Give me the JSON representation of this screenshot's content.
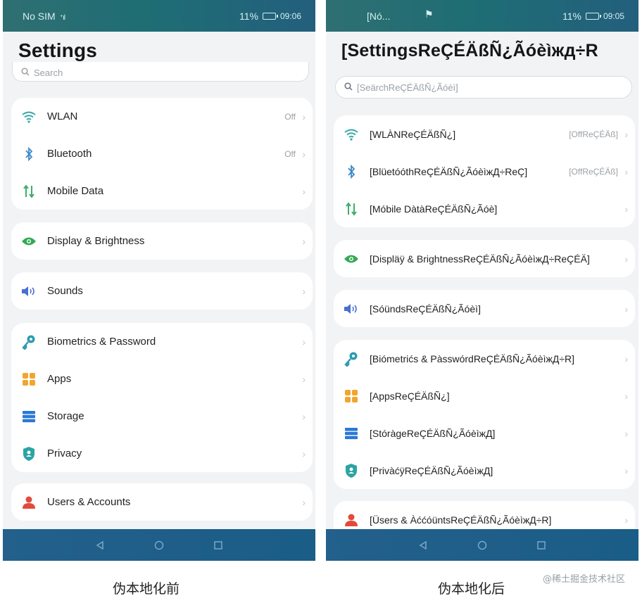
{
  "colors": {
    "statusbar_gradient": [
      "#2f6f72",
      "#235f7d"
    ],
    "navbar": "#1f5e88",
    "wifi": "#3aa6a7",
    "bluetooth": "#3c89c9",
    "mobile_data": "#3fae6a",
    "display": "#34a853",
    "sounds": "#4a6fd1",
    "biometrics": "#2a9bb0",
    "apps": "#f2a52c",
    "storage": "#2b78d4",
    "privacy": "#2ca3a5",
    "users": "#e14b3c"
  },
  "before": {
    "status": {
      "carrier": "No SIM",
      "battery": "11%",
      "time": "09:06"
    },
    "title": "Settings",
    "search_placeholder": "Search",
    "groups": [
      {
        "items": [
          {
            "icon": "wifi-icon",
            "label": "WLAN",
            "value": "Off"
          },
          {
            "icon": "bluetooth-icon",
            "label": "Bluetooth",
            "value": "Off"
          },
          {
            "icon": "mobile-data-icon",
            "label": "Mobile Data",
            "value": ""
          }
        ]
      },
      {
        "items": [
          {
            "icon": "eye-icon",
            "label": "Display & Brightness",
            "value": ""
          }
        ]
      },
      {
        "items": [
          {
            "icon": "speaker-icon",
            "label": "Sounds",
            "value": ""
          }
        ]
      },
      {
        "items": [
          {
            "icon": "key-icon",
            "label": "Biometrics & Password",
            "value": ""
          },
          {
            "icon": "apps-grid-icon",
            "label": "Apps",
            "value": ""
          },
          {
            "icon": "storage-icon",
            "label": "Storage",
            "value": ""
          },
          {
            "icon": "privacy-shield-icon",
            "label": "Privacy",
            "value": ""
          }
        ]
      },
      {
        "items": [
          {
            "icon": "user-icon",
            "label": "Users & Accounts",
            "value": ""
          }
        ]
      }
    ]
  },
  "after": {
    "status": {
      "carrier": "[Nó...",
      "battery": "11%",
      "time": "09:05"
    },
    "title": "[SettingsReÇÉÄßÑ¿Ãóèìжд÷R",
    "search_placeholder": "[SeärchReÇÉÄßÑ¿Ãóèì]",
    "groups": [
      {
        "items": [
          {
            "icon": "wifi-icon",
            "label": "[WLÀNReÇÉÄßÑ¿]",
            "value": "[OffReÇÉÄß]"
          },
          {
            "icon": "bluetooth-icon",
            "label": "[BlüetóóthReÇÉÄßÑ¿ÃóèìжД÷ReÇ]",
            "value": "[OffReÇÉÄß]"
          },
          {
            "icon": "mobile-data-icon",
            "label": "[Móbile DàtàReÇÉÄßÑ¿Ãóè]",
            "value": ""
          }
        ]
      },
      {
        "items": [
          {
            "icon": "eye-icon",
            "label": "[Displäÿ & BrightnessReÇÉÄßÑ¿ÃóèìжД÷ReÇÉÄ]",
            "value": ""
          }
        ]
      },
      {
        "items": [
          {
            "icon": "speaker-icon",
            "label": "[SóündsReÇÉÄßÑ¿Ãóèì]",
            "value": ""
          }
        ]
      },
      {
        "items": [
          {
            "icon": "key-icon",
            "label": "[Biómetrićs & PàsswórdReÇÉÄßÑ¿ÃóèìжД÷R]",
            "value": ""
          },
          {
            "icon": "apps-grid-icon",
            "label": "[AppsReÇÉÄßÑ¿]",
            "value": ""
          },
          {
            "icon": "storage-icon",
            "label": "[StóràgeReÇÉÄßÑ¿ÃóèìжД]",
            "value": ""
          },
          {
            "icon": "privacy-shield-icon",
            "label": "[PrivàćÿReÇÉÄßÑ¿ÃóèìжД]",
            "value": ""
          }
        ]
      },
      {
        "items": [
          {
            "icon": "user-icon",
            "label": "[Üsers & ÀććóüntsReÇÉÄßÑ¿ÃóèìжД÷R]",
            "value": ""
          }
        ]
      }
    ]
  },
  "captions": {
    "left": "伪本地化前",
    "right": "伪本地化后"
  },
  "watermark": "@稀土掘金技术社区"
}
